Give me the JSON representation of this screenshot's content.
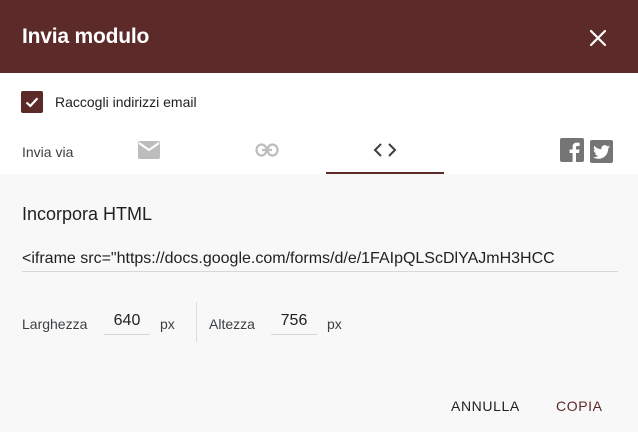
{
  "dialog": {
    "title": "Invia modulo",
    "close_icon": "close-icon"
  },
  "collect_emails": {
    "label": "Raccogli indirizzi email",
    "checked": true
  },
  "send_via": {
    "label": "Invia via",
    "tabs": [
      {
        "icon": "email-icon",
        "active": false
      },
      {
        "icon": "link-icon",
        "active": false
      },
      {
        "icon": "embed-code-icon",
        "active": true
      }
    ],
    "social": [
      {
        "icon": "facebook-icon"
      },
      {
        "icon": "twitter-icon"
      }
    ]
  },
  "embed": {
    "title": "Incorpora HTML",
    "code": "<iframe src=\"https://docs.google.com/forms/d/e/1FAIpQLScDlYAJmH3HCC",
    "width_label": "Larghezza",
    "width_value": "640",
    "height_label": "Altezza",
    "height_value": "756",
    "unit": "px"
  },
  "actions": {
    "cancel_label": "ANNULLA",
    "copy_label": "COPIA"
  },
  "colors": {
    "accent": "#5c2a29",
    "icon_gray": "#bdbdbd",
    "social_gray": "#757575"
  }
}
